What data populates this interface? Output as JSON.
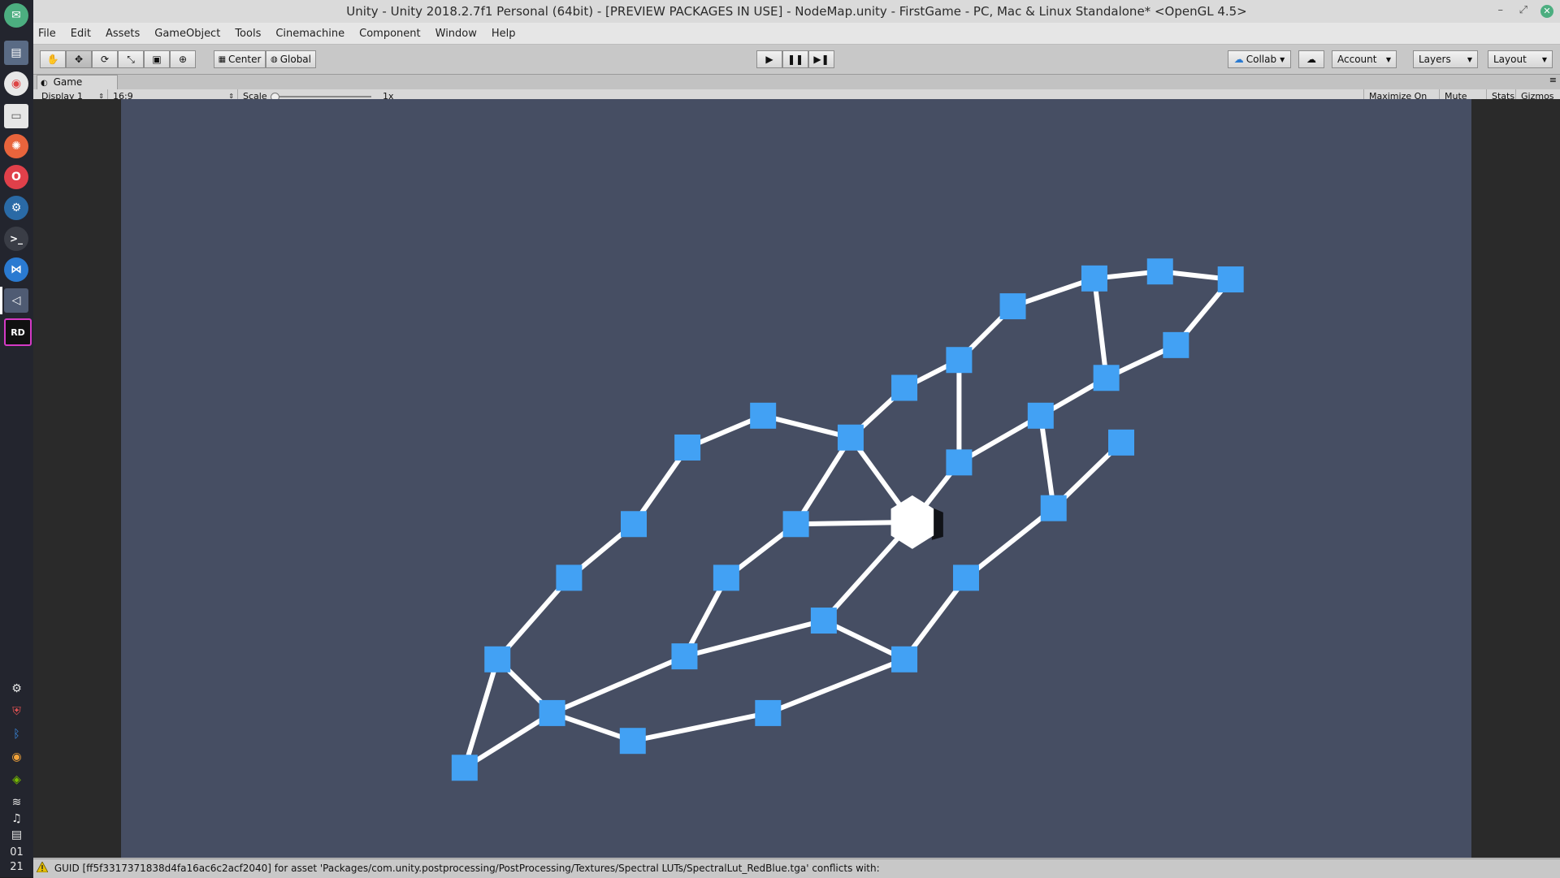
{
  "window": {
    "title": "Unity - Unity 2018.2.7f1 Personal (64bit) - [PREVIEW PACKAGES IN USE] - NodeMap.unity - FirstGame - PC, Mac & Linux Standalone* <OpenGL 4.5>"
  },
  "menu": [
    "File",
    "Edit",
    "Assets",
    "GameObject",
    "Tools",
    "Cinemachine",
    "Component",
    "Window",
    "Help"
  ],
  "toolbar": {
    "pivot_label": "Center",
    "space_label": "Global",
    "collab_label": "Collab",
    "account_label": "Account",
    "layers_label": "Layers",
    "layout_label": "Layout"
  },
  "game_view": {
    "tab_label": "Game",
    "display": "Display 1",
    "aspect": "16:9",
    "scale_label": "Scale",
    "scale_value": "1x",
    "scale_fraction": 0.0,
    "maximize_label": "Maximize On Play",
    "mute_label": "Mute Audio",
    "stats_label": "Stats",
    "gizmos_label": "Gizmos"
  },
  "dock_clock": {
    "hour": "01",
    "minute": "21"
  },
  "status": {
    "message": "GUID [ff5f3317371838d4fa16ac6c2acf2040] for asset 'Packages/com.unity.postprocessing/PostProcessing/Textures/Spectral LUTs/SpectralLut_RedBlue.tga' conflicts with:"
  },
  "colors": {
    "scene_bg": "#464e63",
    "node": "#42a1f4",
    "edge": "#ffffff",
    "player": "#ffffff"
  }
}
